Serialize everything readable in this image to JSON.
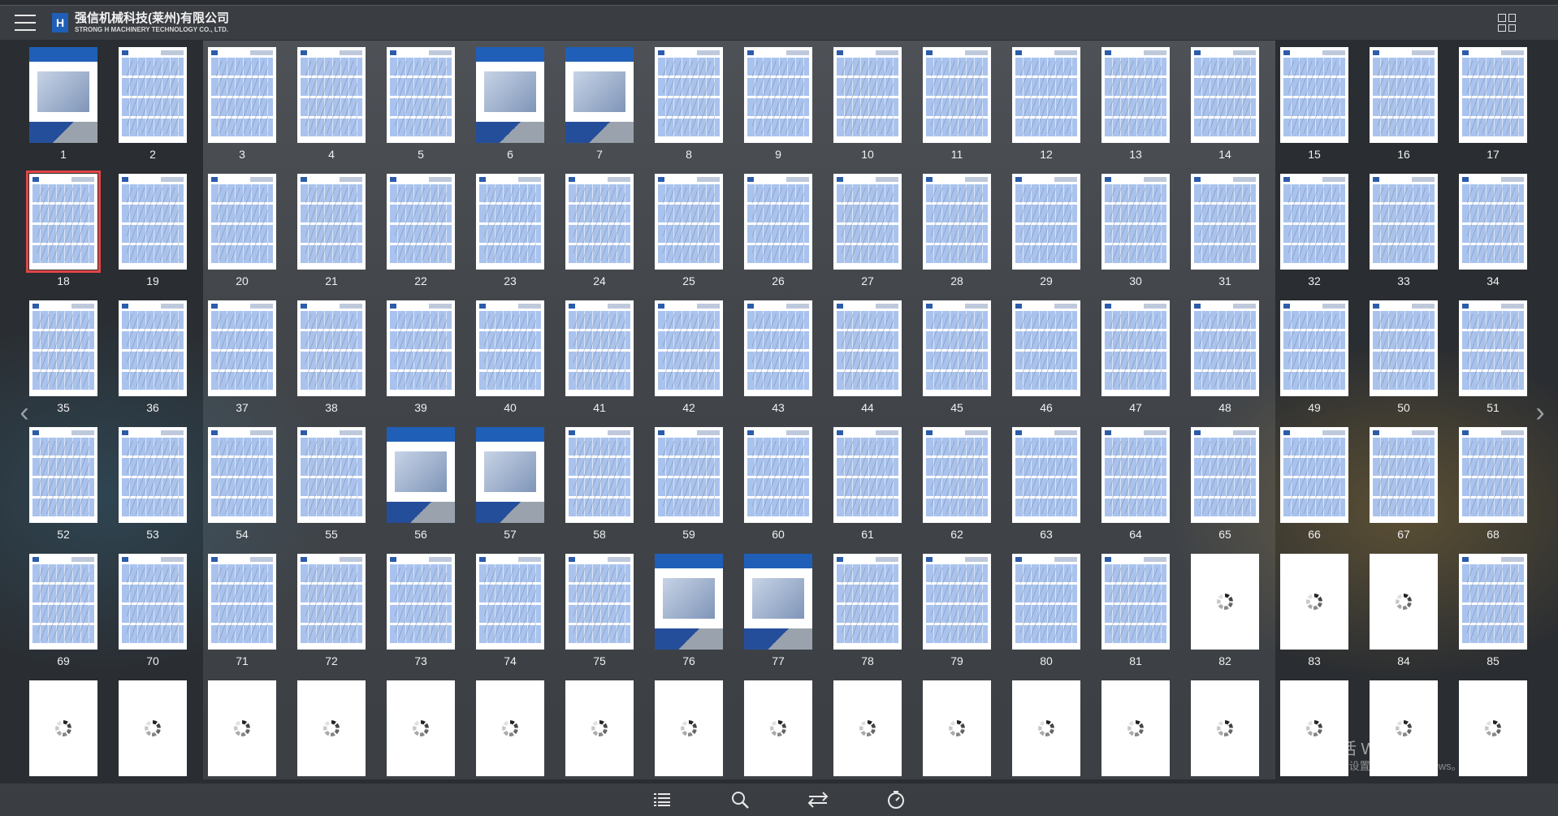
{
  "header": {
    "logo_letter": "H",
    "company_cn": "强信机械科技(莱州)有限公司",
    "company_en": "STRONG H MACHINERY TECHNOLOGY CO., LTD.",
    "menu_icon": "hamburger-menu-icon",
    "view_icon": "grid-view-icon"
  },
  "thumbnails": {
    "current_page": 18,
    "total_shown": 102,
    "pages": [
      1,
      2,
      3,
      4,
      5,
      6,
      7,
      8,
      9,
      10,
      11,
      12,
      13,
      14,
      15,
      16,
      17,
      18,
      19,
      20,
      21,
      22,
      23,
      24,
      25,
      26,
      27,
      28,
      29,
      30,
      31,
      32,
      33,
      34,
      35,
      36,
      37,
      38,
      39,
      40,
      41,
      42,
      43,
      44,
      45,
      46,
      47,
      48,
      49,
      50,
      51,
      52,
      53,
      54,
      55,
      56,
      57,
      58,
      59,
      60,
      61,
      62,
      63,
      64,
      65,
      66,
      67,
      68,
      69,
      70,
      71,
      72,
      73,
      74,
      75,
      76,
      77,
      78,
      79,
      80,
      81,
      82,
      83,
      84,
      85
    ],
    "cover_pages": [
      1,
      6,
      7,
      56,
      57,
      76,
      77
    ],
    "loading_pages": [
      82,
      83,
      84
    ],
    "last_row_loading": 17
  },
  "toolbar": {
    "buttons": [
      "table-of-contents-icon",
      "search-icon",
      "flip-pages-icon",
      "autoplay-timer-icon"
    ]
  },
  "watermark": {
    "line1": "激活 Windows",
    "line2": "转到\"设置\"以激活 Windows。"
  },
  "colors": {
    "background": "#2a2d31",
    "bar": "#3a3d42",
    "page_blue": "#a9c3ee",
    "selected_outline": "#e04646",
    "brand_blue": "#1f5fb8"
  }
}
